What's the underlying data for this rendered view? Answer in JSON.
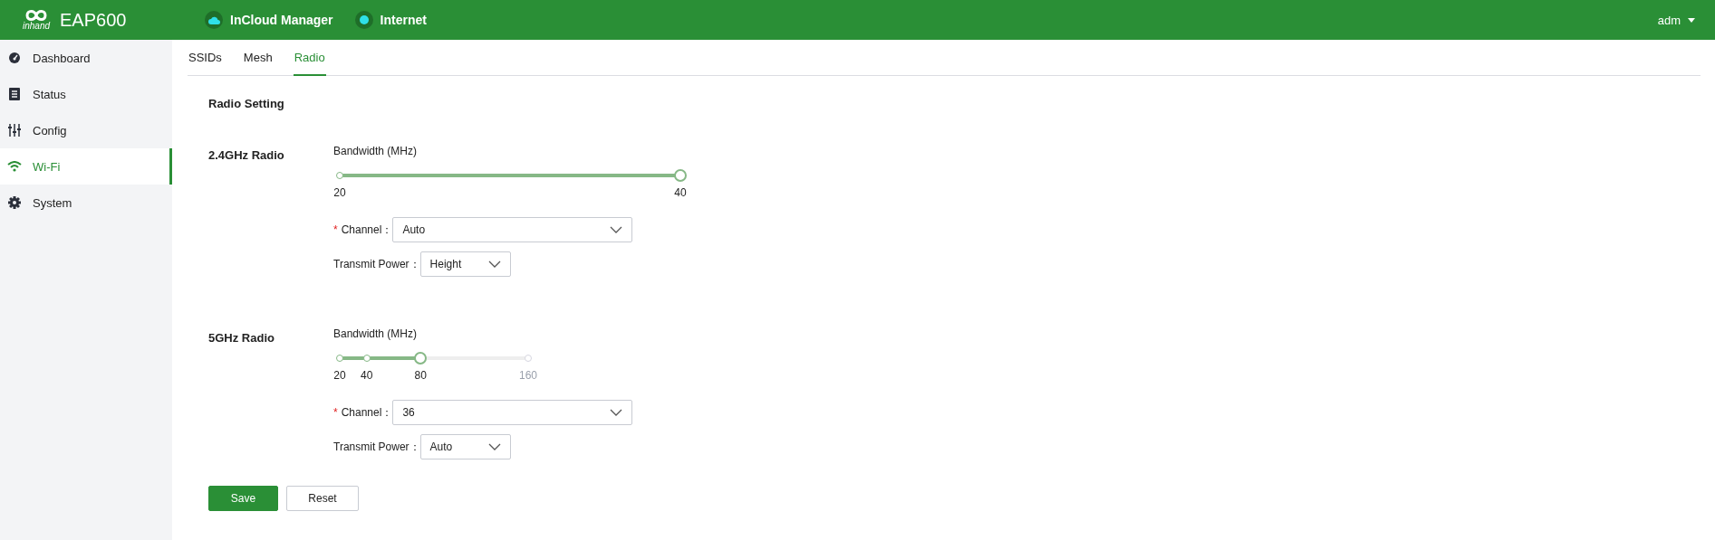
{
  "header": {
    "logo_text": "inhand",
    "product": "EAP600",
    "statuses": [
      {
        "kind": "cloud",
        "label": "InCloud Manager"
      },
      {
        "kind": "dot",
        "label": "Internet"
      }
    ],
    "user": "adm"
  },
  "sidebar": {
    "items": [
      {
        "label": "Dashboard",
        "selected": false
      },
      {
        "label": "Status",
        "selected": false
      },
      {
        "label": "Config",
        "selected": false
      },
      {
        "label": "Wi-Fi",
        "selected": true
      },
      {
        "label": "System",
        "selected": false
      }
    ]
  },
  "tabs": [
    {
      "label": "SSIDs",
      "selected": false
    },
    {
      "label": "Mesh",
      "selected": false
    },
    {
      "label": "Radio",
      "selected": true
    }
  ],
  "section_title": "Radio Setting",
  "radios": [
    {
      "name": "2.4GHz Radio",
      "bandwidth_label": "Bandwidth (MHz)",
      "level": 1,
      "marks": [
        "20",
        "40"
      ],
      "required_mark": "*",
      "channel_label": "Channel：",
      "channel": "Auto",
      "power_label": "Transmit Power：",
      "power": "Height"
    },
    {
      "name": "5GHz Radio",
      "bandwidth_label": "Bandwidth (MHz)",
      "level": 0.43,
      "marks": [
        "20",
        "40",
        "80",
        "160"
      ],
      "required_mark": "*",
      "channel_label": "Channel：",
      "channel": "36",
      "power_label": "Transmit Power：",
      "power": "Auto"
    }
  ],
  "buttons": [
    {
      "kind": "primary",
      "label": "Save"
    },
    {
      "kind": "default",
      "label": "Reset"
    }
  ]
}
